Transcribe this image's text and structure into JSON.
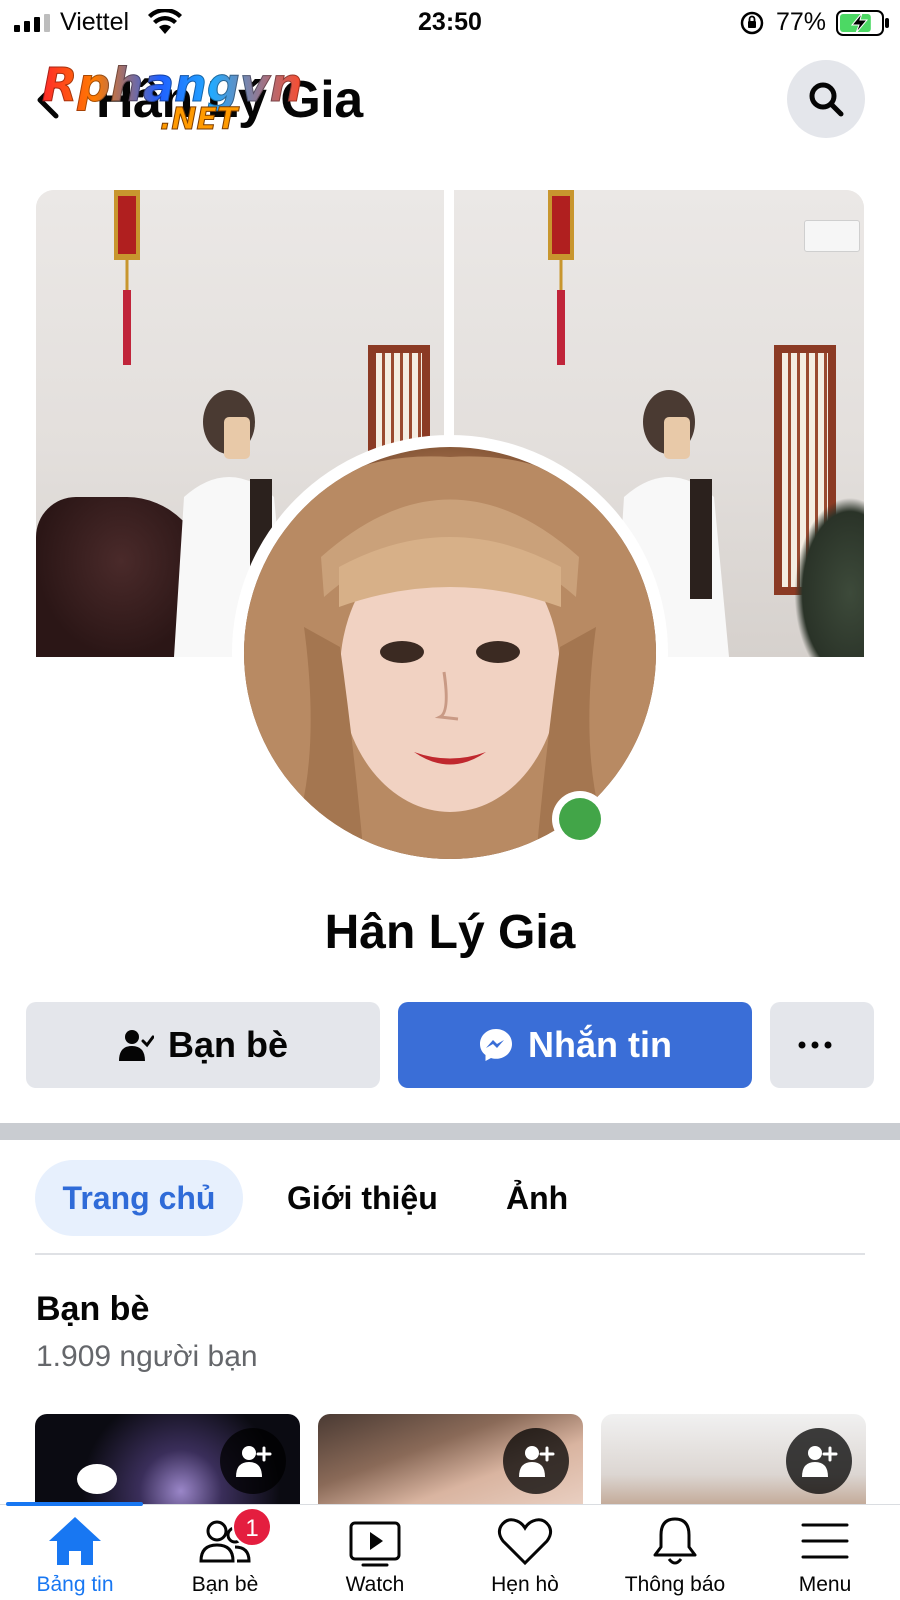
{
  "status_bar": {
    "carrier": "Viettel",
    "time": "23:50",
    "battery_percent": "77%",
    "battery_level": 0.77,
    "charging": true
  },
  "header": {
    "title": "Hân Lý Gia",
    "watermark_main": "Rphangvn",
    "watermark_sub": ".NET",
    "back_icon": "chevron-left-icon",
    "search_icon": "search-icon"
  },
  "profile": {
    "name": "Hân Lý Gia",
    "online": true,
    "online_color": "#42a548"
  },
  "actions": {
    "friends_label": "Bạn bè",
    "message_label": "Nhắn tin",
    "more_icon": "more-dots-icon",
    "message_color": "#3a6ed7"
  },
  "tabs": [
    {
      "label": "Trang chủ",
      "active": true
    },
    {
      "label": "Giới thiệu",
      "active": false
    },
    {
      "label": "Ảnh",
      "active": false
    }
  ],
  "friends_section": {
    "title": "Bạn bè",
    "count": "1.909 người bạn"
  },
  "bottom_nav": [
    {
      "label": "Bảng tin",
      "icon": "home-icon",
      "active": true
    },
    {
      "label": "Bạn bè",
      "icon": "friends-icon",
      "badge": "1",
      "active": false
    },
    {
      "label": "Watch",
      "icon": "watch-icon",
      "active": false
    },
    {
      "label": "Hẹn hò",
      "icon": "dating-heart-icon",
      "active": false
    },
    {
      "label": "Thông báo",
      "icon": "bell-icon",
      "active": false
    },
    {
      "label": "Menu",
      "icon": "menu-icon",
      "active": false
    }
  ],
  "colors": {
    "accent": "#1877f2",
    "badge": "#e41e3f",
    "active_tab_bg": "#e7f0fd"
  }
}
